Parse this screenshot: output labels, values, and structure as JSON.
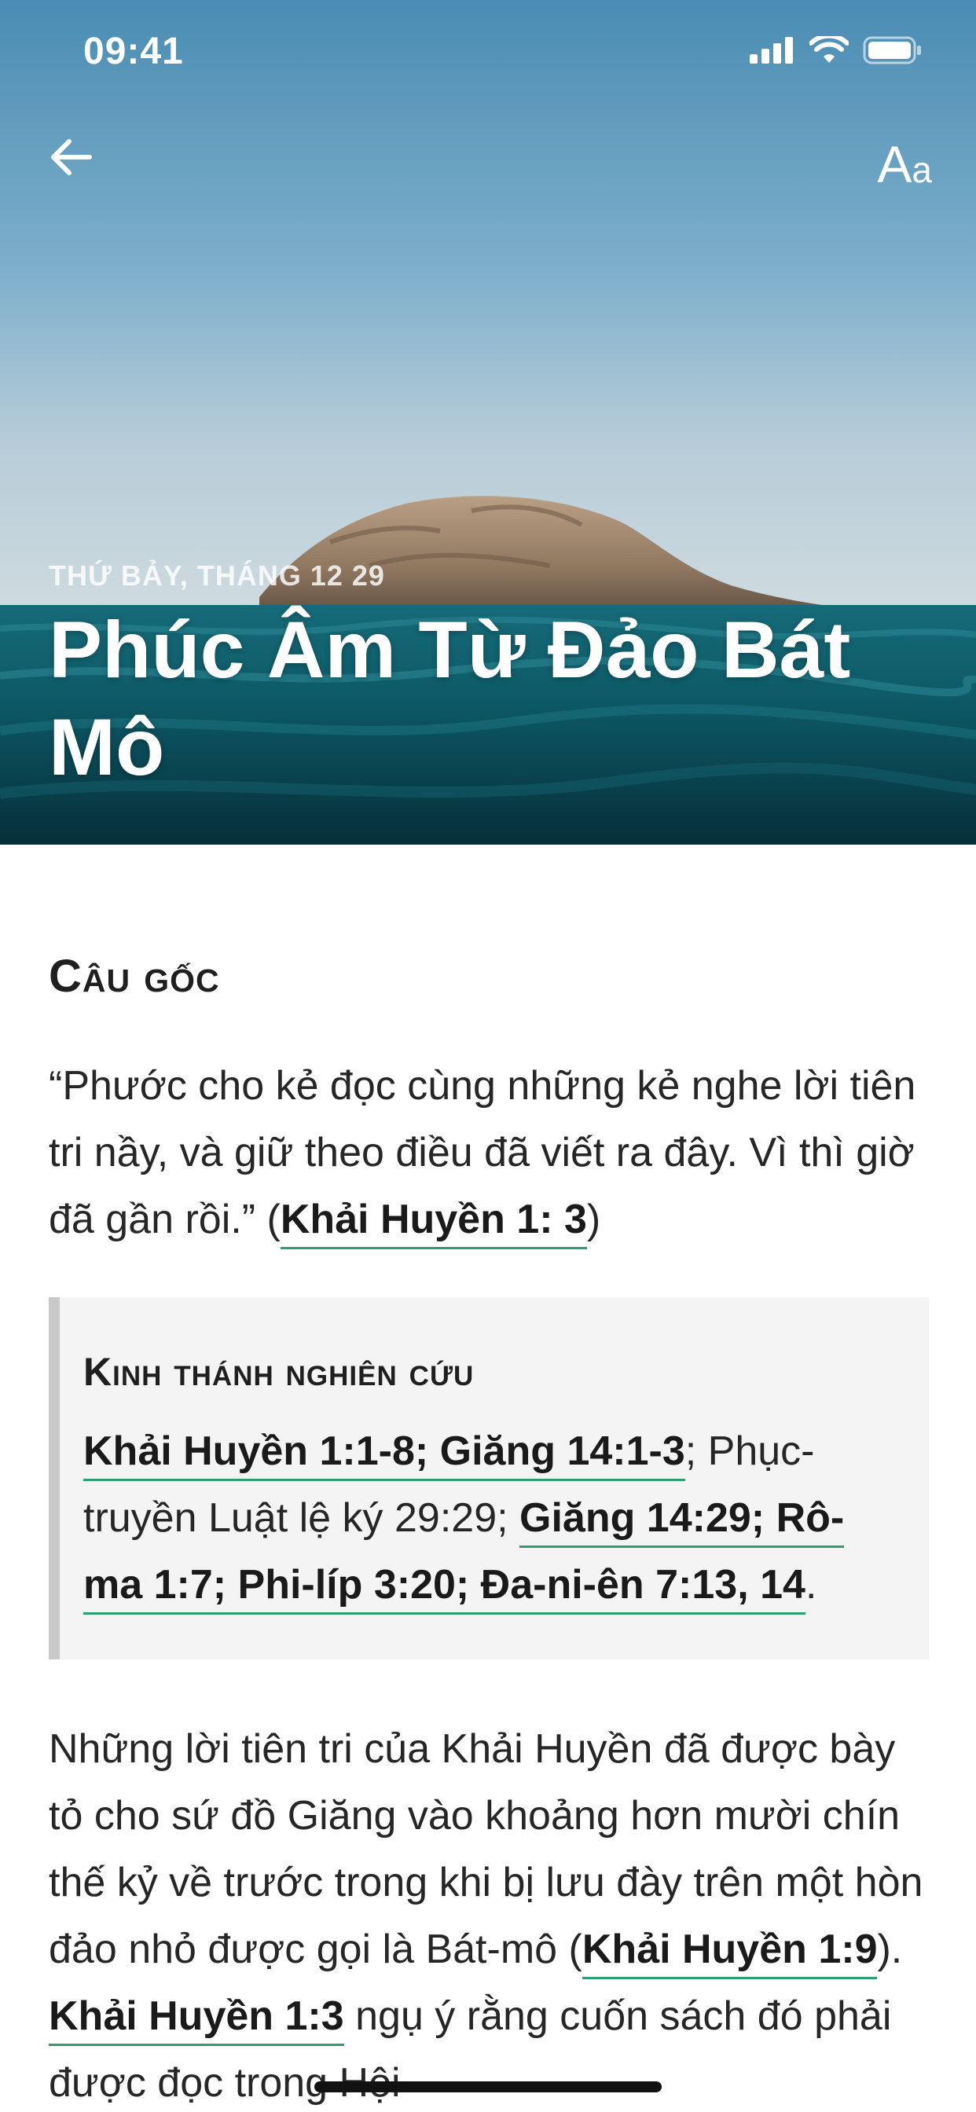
{
  "status_bar": {
    "time": "09:41"
  },
  "nav": {
    "font_button_big": "A",
    "font_button_small": "a"
  },
  "hero": {
    "date": "THỨ BẢY, THÁNG 12 29",
    "title": "Phúc Âm Từ Đảo Bát Mô"
  },
  "memory": {
    "heading": "Câu gốc",
    "quote": "“Phước cho kẻ đọc cùng những kẻ nghe lời tiên tri nầy, và giữ theo điều đã viết ra đây. Vì thì giờ đã gần rồi.” (",
    "reference": "Khải Huyền 1: 3",
    "close": ")"
  },
  "study": {
    "heading": "Kinh thánh nghiên cứu",
    "link1": "Khải Huyền 1:1-8; Giăng 14:1-3",
    "plain1": "; Phục-truyền Luật lệ ký 29:29; ",
    "link2": "Giăng 14:29; Rô-ma 1:7; Phi-líp 3:20; Đa-ni-ên 7:13, 14",
    "end": "."
  },
  "body": {
    "text1": "Những lời tiên tri của Khải Huyền đã được bày tỏ cho sứ đồ Giăng vào khoảng hơn mười chín thế kỷ về trước trong khi bị lưu đày trên một hòn đảo nhỏ được gọi là Bát-mô (",
    "link1": "Khải Huyền 1:9",
    "text2": "). ",
    "link2": "Khải Huyền 1:3",
    "text3": " ngụ ý rằng cuốn sách đó phải được đọc trong Hội"
  },
  "colors": {
    "link_underline": "#2e9e6f",
    "study_box_bg": "#f4f4f4",
    "study_box_border": "#c9c9c9",
    "text": "#262626"
  },
  "icons": [
    "signal-icon",
    "wifi-icon",
    "battery-icon",
    "back-arrow-icon",
    "font-size-icon"
  ]
}
